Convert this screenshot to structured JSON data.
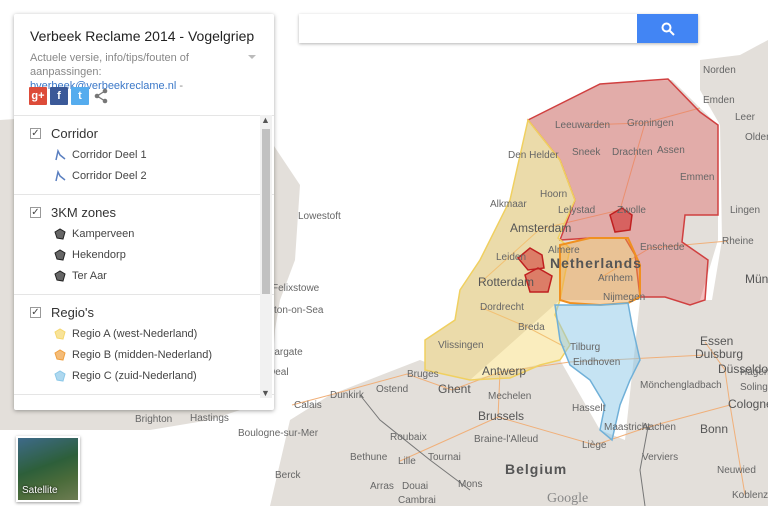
{
  "panel": {
    "title": "Verbeek Reclame 2014 - Vogelgriep",
    "description": "Actuele versie, info/tips/fouten of aanpassingen: ",
    "email": "bverbeek@verbeekreclame.nl",
    "desc_suffix": " -",
    "social": [
      {
        "icon": "google-plus-icon",
        "label": "g+",
        "color": "#dd4b39"
      },
      {
        "icon": "facebook-icon",
        "label": "f",
        "color": "#3b5998"
      },
      {
        "icon": "twitter-icon",
        "label": "t",
        "color": "#55acee"
      },
      {
        "icon": "share-icon",
        "label": "",
        "color": "#777"
      }
    ],
    "layers": [
      {
        "name": "Corridor",
        "checked": true,
        "items": [
          {
            "label": "Corridor Deel 1",
            "icon": "line-icon"
          },
          {
            "label": "Corridor Deel 2",
            "icon": "line-icon"
          }
        ]
      },
      {
        "name": "3KM zones",
        "checked": true,
        "items": [
          {
            "label": "Kamperveen",
            "icon": "polygon-icon"
          },
          {
            "label": "Hekendorp",
            "icon": "polygon-icon"
          },
          {
            "label": "Ter Aar",
            "icon": "polygon-icon"
          }
        ]
      },
      {
        "name": "Regio's",
        "checked": true,
        "items": [
          {
            "label": "Regio A (west-Nederland)",
            "icon": "polygon-icon",
            "color": "#f5d76e"
          },
          {
            "label": "Regio B (midden-Nederland)",
            "icon": "polygon-icon",
            "color": "#f0a040"
          },
          {
            "label": "Regio C (zuid-Nederland)",
            "icon": "polygon-icon",
            "color": "#8cc8e8"
          }
        ]
      }
    ]
  },
  "search": {
    "placeholder": "",
    "button_icon": "search-icon",
    "color": "#4285f4"
  },
  "satellite": {
    "label": "Satellite"
  },
  "map": {
    "region_colors": {
      "a": "#f5d76e",
      "b": "#f0a040",
      "c": "#8cc8e8",
      "north": "#e06060"
    },
    "countries": [
      "Netherlands",
      "Belgium"
    ],
    "cities": [
      "Norden",
      "Emden",
      "Leer",
      "Olden",
      "Leeuwarden",
      "Groningen",
      "Den Helder",
      "Sneek",
      "Drachten",
      "Assen",
      "Emmen",
      "Hoorn",
      "Alkmaar",
      "Lelystad",
      "Zwolle",
      "Lingen",
      "Amsterdam",
      "Almere",
      "Rheine",
      "Enschede",
      "Leiden",
      "Arnhem",
      "Münster",
      "Rotterdam",
      "Nijmegen",
      "Dordrecht",
      "Breda",
      "Vlissingen",
      "Tilburg",
      "Eindhoven",
      "Essen",
      "Duisburg",
      "Düsseldorf",
      "Hagen",
      "Bruges",
      "Antwerp",
      "Mönchengladbach",
      "Solingen",
      "Ostend",
      "Ghent",
      "Dunkirk",
      "Mechelen",
      "Calais",
      "Hasselt",
      "Cologne",
      "Brussels",
      "Maastricht",
      "Aachen",
      "Bonn",
      "Boulogne-sur-Mer",
      "Roubaix",
      "Braine-l'Alleud",
      "Liège",
      "Bethune",
      "Lille",
      "Tournai",
      "Verviers",
      "Neuwied",
      "Berck",
      "Arras",
      "Douai",
      "Mons",
      "Cambrai",
      "Koblenz",
      "Lowestoft",
      "Felixstowe",
      "Clacton-on-Sea",
      "Margate",
      "Deal",
      "Brighton",
      "Hastings"
    ],
    "attribution": "Google"
  }
}
